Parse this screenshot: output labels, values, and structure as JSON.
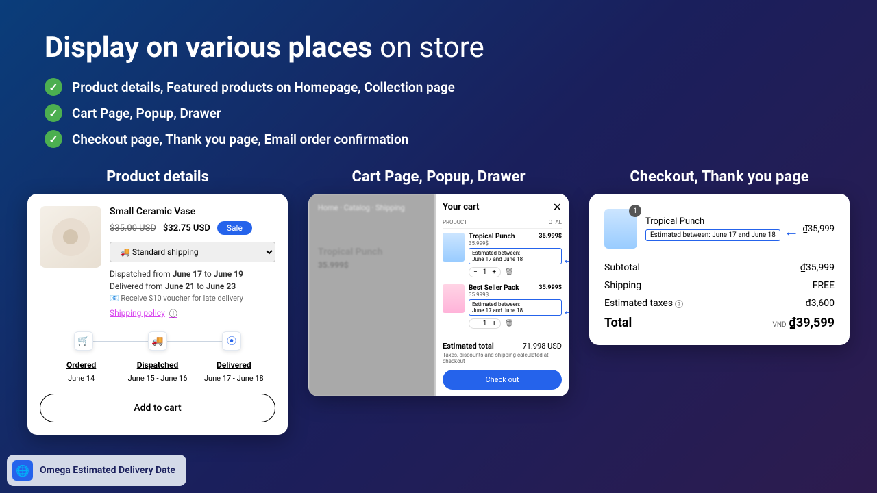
{
  "title_bold": "Display on various places",
  "title_light": " on store",
  "bullets": [
    "Product details, Featured products on Homepage, Collection page",
    "Cart Page, Popup, Drawer",
    "Checkout page, Thank you page, Email order confirmation"
  ],
  "col1": {
    "title": "Product details",
    "product_name": "Small Ceramic Vase",
    "old_price": "$35.00 USD",
    "price": "$32.75 USD",
    "sale": "Sale",
    "shipping_option": "🚚 Standard shipping",
    "dispatch_pre": "Dispatched from ",
    "dispatch_d1": "June 17",
    "dispatch_mid": " to ",
    "dispatch_d2": "June 19",
    "deliver_pre": "Delivered from ",
    "deliver_d1": "June 21",
    "deliver_mid": " to ",
    "deliver_d2": "June 23",
    "voucher": "📧 Receive $10 voucher for late delivery",
    "policy": "Shipping policy",
    "timeline": {
      "l1": "Ordered",
      "l2": "Dispatched",
      "l3": "Delivered",
      "d1": "June 14",
      "d2": "June 15 - June 16",
      "d3": "June 17 - June 18"
    },
    "atc": "Add to cart"
  },
  "col2": {
    "title": "Cart Page, Popup, Drawer",
    "bg_product": "Tropical Punch",
    "bg_price": "35.999$",
    "cart_title": "Your cart",
    "cols": {
      "p": "PRODUCT",
      "t": "TOTAL"
    },
    "item1": {
      "name": "Tropical Punch",
      "sub": "35.999$",
      "est_l1": "Estimated between:",
      "est_l2": "June 17 and June 18",
      "price": "35.999$",
      "qty": "1"
    },
    "item2": {
      "name": "Best Seller Pack",
      "sub": "35.999$",
      "est_l1": "Estimated between:",
      "est_l2": "June 17 and June 18",
      "price": "35.999$",
      "qty": "1"
    },
    "total_label": "Estimated total",
    "total_value": "71.998 USD",
    "note": "Taxes, discounts and shipping calculated at checkout",
    "checkout": "Check out"
  },
  "col3": {
    "title": "Checkout, Thank you page",
    "badge": "1",
    "name": "Tropical Punch",
    "est": "Estimated between: June 17 and June 18",
    "price": "₫35,999",
    "rows": {
      "subtotal_l": "Subtotal",
      "subtotal_v": "₫35,999",
      "shipping_l": "Shipping",
      "shipping_v": "FREE",
      "tax_l": "Estimated taxes",
      "tax_v": "₫3,600",
      "total_l": "Total",
      "currency": "VND",
      "total_v": "₫39,599"
    }
  },
  "footer": "Omega Estimated Delivery Date"
}
